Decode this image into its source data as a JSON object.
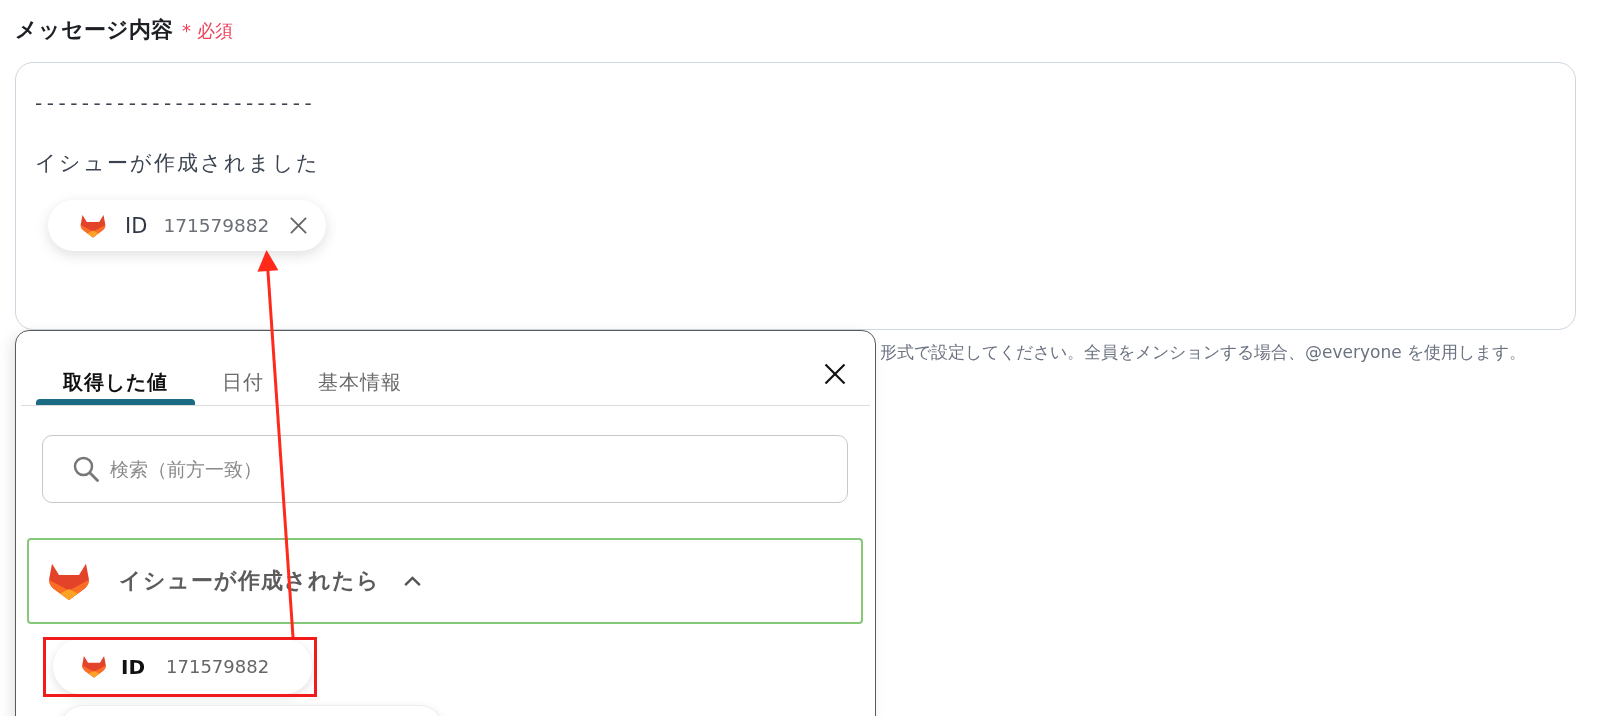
{
  "field": {
    "label": "メッセージ内容",
    "required_mark": "*",
    "required_text": "必須",
    "content": [
      {
        "kind": "separator",
        "text": "------------------------"
      },
      {
        "kind": "text",
        "text": "イシューが作成されました"
      },
      {
        "kind": "token",
        "label": "ID",
        "value": "171579882"
      }
    ],
    "helper_text": "形式で設定してください。全員をメンションする場合、@everyone を使用します。"
  },
  "picker": {
    "tabs": [
      {
        "label": "取得した値",
        "selected": true
      },
      {
        "label": "日付",
        "selected": false
      },
      {
        "label": "基本情報",
        "selected": false
      }
    ],
    "search": {
      "placeholder": "検索（前方一致）"
    },
    "groups": [
      {
        "title": "イシューが作成されたら",
        "expanded": true,
        "items": [
          {
            "label": "ID",
            "value": "171579882",
            "highlighted": true
          },
          {
            "highlighted": false
          }
        ]
      }
    ]
  },
  "annotation": {
    "arrow": true
  }
}
